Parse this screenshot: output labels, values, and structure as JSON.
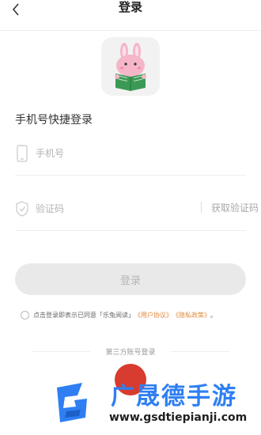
{
  "header": {
    "title": "登录"
  },
  "section_title": "手机号快捷登录",
  "phone_field": {
    "placeholder": "手机号"
  },
  "code_field": {
    "placeholder": "验证码",
    "get_code_label": "获取验证码"
  },
  "login_button": {
    "label": "登录"
  },
  "agreement": {
    "prefix": "点击登录即表示已同意「乐兔阅读」",
    "user_agreement": "《用户协议》",
    "privacy_policy": "《隐私政策》",
    "suffix": "。"
  },
  "third_party": {
    "label": "第三方账号登录"
  },
  "watermark": {
    "text": "广晟德手游",
    "url": "www.gsdtiepianji.com"
  },
  "colors": {
    "accent": "#e08a3c",
    "brand_blue": "#2f7ff3",
    "button_disabled": "#e9e9e9"
  },
  "icons": {
    "back": "chevron-left-icon",
    "phone": "phone-icon",
    "shield": "shield-check-icon",
    "logo": "bunny-reading-logo"
  }
}
